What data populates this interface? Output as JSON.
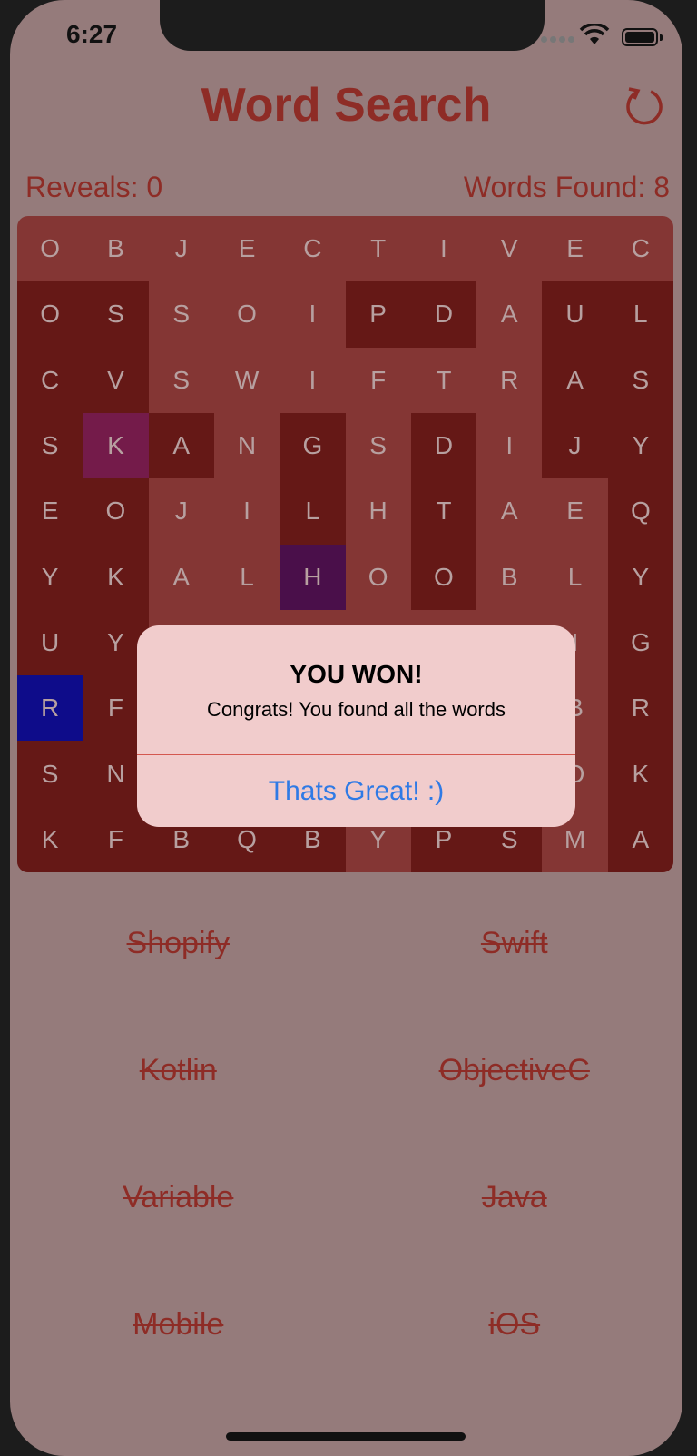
{
  "status_bar": {
    "time": "6:27"
  },
  "header": {
    "title": "Word Search"
  },
  "stats": {
    "reveals": "Reveals: 0",
    "words_found": "Words Found: 8"
  },
  "grid": {
    "rows": [
      [
        "O",
        "B",
        "J",
        "E",
        "C",
        "T",
        "I",
        "V",
        "E",
        "C"
      ],
      [
        "O",
        "S",
        "S",
        "O",
        "I",
        "P",
        "D",
        "A",
        "U",
        "L"
      ],
      [
        "C",
        "V",
        "S",
        "W",
        "I",
        "F",
        "T",
        "R",
        "A",
        "S"
      ],
      [
        "S",
        "K",
        "A",
        "N",
        "G",
        "S",
        "D",
        "I",
        "J",
        "Y"
      ],
      [
        "E",
        "O",
        "J",
        "I",
        "L",
        "H",
        "T",
        "A",
        "E",
        "Q"
      ],
      [
        "Y",
        "K",
        "A",
        "L",
        "H",
        "O",
        "O",
        "B",
        "L",
        "Y"
      ],
      [
        "U",
        "Y",
        "",
        "",
        "",
        "",
        "",
        "",
        "I",
        "G"
      ],
      [
        "R",
        "F",
        "",
        "",
        "",
        "",
        "",
        "",
        "B",
        "R"
      ],
      [
        "S",
        "N",
        "",
        "",
        "",
        "",
        "",
        "",
        "O",
        "K"
      ],
      [
        "K",
        "F",
        "B",
        "Q",
        "B",
        "Y",
        "P",
        "S",
        "M",
        "A"
      ]
    ],
    "highlight_states": [
      [
        "n",
        "n",
        "n",
        "n",
        "n",
        "n",
        "n",
        "n",
        "n",
        "n"
      ],
      [
        "d",
        "d",
        "n",
        "n",
        "n",
        "d",
        "d",
        "n",
        "d",
        "d"
      ],
      [
        "d",
        "d",
        "n",
        "n",
        "n",
        "n",
        "n",
        "n",
        "d",
        "d"
      ],
      [
        "d",
        "k",
        "d",
        "n",
        "d",
        "n",
        "d",
        "n",
        "d",
        "d"
      ],
      [
        "d",
        "d",
        "n",
        "n",
        "d",
        "n",
        "d",
        "n",
        "n",
        "d"
      ],
      [
        "d",
        "d",
        "n",
        "n",
        "h",
        "n",
        "d",
        "n",
        "n",
        "d"
      ],
      [
        "d",
        "d",
        "n",
        "n",
        "n",
        "n",
        "n",
        "n",
        "n",
        "d"
      ],
      [
        "r",
        "d",
        "n",
        "n",
        "n",
        "n",
        "n",
        "n",
        "n",
        "d"
      ],
      [
        "d",
        "d",
        "n",
        "n",
        "n",
        "n",
        "n",
        "n",
        "n",
        "d"
      ],
      [
        "d",
        "d",
        "d",
        "d",
        "d",
        "n",
        "d",
        "d",
        "n",
        "d"
      ]
    ],
    "colors": {
      "normal": "#843634",
      "found": "#651816",
      "k_highlight": "#741b4a",
      "h_highlight": "#4a0f4a",
      "r_highlight": "#0e0c8a"
    }
  },
  "words": [
    "Shopify",
    "Swift",
    "Kotlin",
    "ObjectiveC",
    "Variable",
    "Java",
    "Mobile",
    "iOS"
  ],
  "alert": {
    "title": "YOU WON!",
    "message": "Congrats! You found all the words",
    "button": "Thats Great! :)"
  }
}
